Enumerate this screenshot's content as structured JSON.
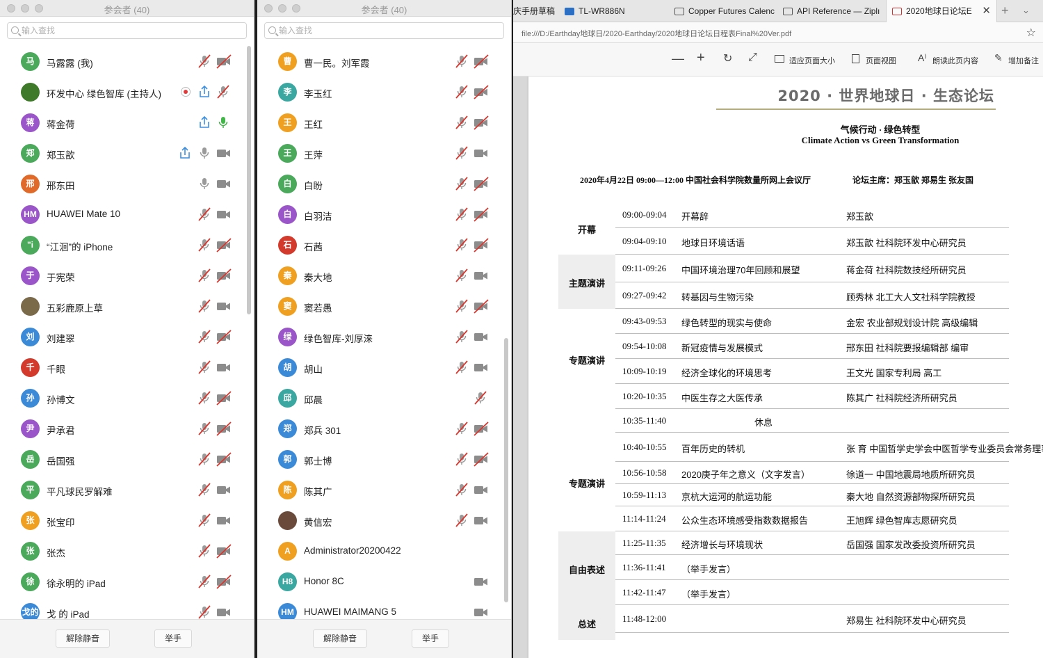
{
  "colors": {
    "red_slash": "#d9352c",
    "mic_green": "#43b649",
    "share_blue": "#3d8fe0",
    "record_red": "#e23a3a"
  },
  "left_panel": {
    "title": "参会者 (40)",
    "search_placeholder": "输入查找",
    "unmute_label": "解除静音",
    "raise_hand_label": "举手",
    "participants": [
      {
        "initial": "马",
        "name": "马露露 (我)",
        "color": "#4aa95a",
        "mic": "muted",
        "video": "off"
      },
      {
        "initial": "",
        "name": "环发中心 绿色智库 (主持人)",
        "color": "#3f7a2a",
        "mic": "muted",
        "video": "none",
        "recording": true,
        "sharing": true
      },
      {
        "initial": "蒋",
        "name": "蒋金荷",
        "color": "#9a55c8",
        "mic": "active",
        "video": "none",
        "sharing": true
      },
      {
        "initial": "郑",
        "name": "郑玉歆",
        "color": "#4aa95a",
        "mic": "on",
        "video": "on",
        "sharing": true
      },
      {
        "initial": "邢",
        "name": "邢东田",
        "color": "#e06a2a",
        "mic": "on",
        "video": "on"
      },
      {
        "initial": "HM",
        "name": "HUAWEI Mate 10",
        "color": "#9a55c8",
        "mic": "muted",
        "video": "on"
      },
      {
        "initial": "\"i",
        "name": "“江洄”的 iPhone",
        "color": "#4aa95a",
        "mic": "muted",
        "video": "off"
      },
      {
        "initial": "于",
        "name": "于宪荣",
        "color": "#9a55c8",
        "mic": "muted",
        "video": "off"
      },
      {
        "initial": "",
        "name": "五彩鹿原上草",
        "color": "#7a6a4a",
        "mic": "muted",
        "video": "on"
      },
      {
        "initial": "刘",
        "name": "刘建翠",
        "color": "#3a8ad8",
        "mic": "muted",
        "video": "off"
      },
      {
        "initial": "千",
        "name": "千眼",
        "color": "#d33a2c",
        "mic": "muted",
        "video": "on"
      },
      {
        "initial": "孙",
        "name": "孙博文",
        "color": "#3a8ad8",
        "mic": "muted",
        "video": "off"
      },
      {
        "initial": "尹",
        "name": "尹承君",
        "color": "#9a55c8",
        "mic": "muted",
        "video": "off"
      },
      {
        "initial": "岳",
        "name": "岳国强",
        "color": "#4aa95a",
        "mic": "muted",
        "video": "off"
      },
      {
        "initial": "平",
        "name": "平凡球民罗解难",
        "color": "#4aa95a",
        "mic": "muted",
        "video": "on"
      },
      {
        "initial": "张",
        "name": "张宝印",
        "color": "#f0a020",
        "mic": "muted",
        "video": "on"
      },
      {
        "initial": "张",
        "name": "张杰",
        "color": "#4aa95a",
        "mic": "muted",
        "video": "off"
      },
      {
        "initial": "徐",
        "name": "徐永明的 iPad",
        "color": "#4aa95a",
        "mic": "muted",
        "video": "off"
      },
      {
        "initial": "戈的",
        "name": "戈 的 iPad",
        "color": "#3a8ad8",
        "mic": "muted",
        "video": "on"
      }
    ]
  },
  "mid_panel": {
    "title": "参会者 (40)",
    "search_placeholder": "输入查找",
    "unmute_label": "解除静音",
    "raise_hand_label": "举手",
    "participants": [
      {
        "initial": "曹",
        "name": "曹一民。刘军霞",
        "color": "#f0a020",
        "mic": "muted",
        "video": "off"
      },
      {
        "initial": "李",
        "name": "李玉红",
        "color": "#3aa8a0",
        "mic": "muted",
        "video": "off"
      },
      {
        "initial": "王",
        "name": "王红",
        "color": "#f0a020",
        "mic": "muted",
        "video": "off"
      },
      {
        "initial": "王",
        "name": "王萍",
        "color": "#4aa95a",
        "mic": "muted",
        "video": "on"
      },
      {
        "initial": "白",
        "name": "白盼",
        "color": "#4aa95a",
        "mic": "muted",
        "video": "off"
      },
      {
        "initial": "白",
        "name": "白羽洁",
        "color": "#9a55c8",
        "mic": "muted",
        "video": "off"
      },
      {
        "initial": "石",
        "name": "石茜",
        "color": "#d33a2c",
        "mic": "muted",
        "video": "off"
      },
      {
        "initial": "秦",
        "name": "秦大地",
        "color": "#f0a020",
        "mic": "muted",
        "video": "on"
      },
      {
        "initial": "窦",
        "name": "窦若愚",
        "color": "#f0a020",
        "mic": "muted",
        "video": "off"
      },
      {
        "initial": "绿",
        "name": "绿色智库-刘厚涞",
        "color": "#9a55c8",
        "mic": "muted",
        "video": "on"
      },
      {
        "initial": "胡",
        "name": "胡山",
        "color": "#3a8ad8",
        "mic": "muted",
        "video": "on"
      },
      {
        "initial": "邱",
        "name": "邱晨",
        "color": "#3aa8a0",
        "mic": "muted",
        "video": "none"
      },
      {
        "initial": "郑",
        "name": "郑兵 301",
        "color": "#3a8ad8",
        "mic": "muted",
        "video": "off"
      },
      {
        "initial": "郭",
        "name": "郭士博",
        "color": "#3a8ad8",
        "mic": "muted",
        "video": "off"
      },
      {
        "initial": "陈",
        "name": "陈其广",
        "color": "#f0a020",
        "mic": "muted",
        "video": "on"
      },
      {
        "initial": "",
        "name": "黄信宏",
        "color": "#6a4a3a",
        "mic": "muted",
        "video": "on"
      },
      {
        "initial": "A",
        "name": "Administrator20200422",
        "color": "#f0a020",
        "mic": "none",
        "video": "none"
      },
      {
        "initial": "H8",
        "name": "Honor 8C",
        "color": "#3aa8a0",
        "mic": "none",
        "video": "on"
      },
      {
        "initial": "HM",
        "name": "HUAWEI MAIMANG 5",
        "color": "#3a8ad8",
        "mic": "none",
        "video": "on"
      }
    ]
  },
  "browser": {
    "tabs": [
      {
        "label": "庆手册草稿",
        "icon": "none"
      },
      {
        "label": "TL-WR886N",
        "icon": "tp-link-icon"
      },
      {
        "label": "Copper Futures Calenc",
        "icon": "page-icon"
      },
      {
        "label": "API Reference — Ziplı",
        "icon": "page-icon"
      },
      {
        "label": "2020地球日论坛E",
        "icon": "pdf-icon",
        "active": true
      }
    ],
    "url": "file:///D:/Earthday地球日/2020-Earthday/2020地球日论坛日程表Final%20Ver.pdf",
    "toolbar": {
      "fit_page": "适应页面大小",
      "page_view": "页面视图",
      "read_aloud": "朗读此页内容",
      "add_note": "增加备注"
    }
  },
  "document": {
    "title": "2020 · 世界地球日 · 生态论坛",
    "subtitle_cn": "气候行动 · 绿色转型",
    "subtitle_en": "Climate Action vs Green Transformation",
    "meta_left": "2020年4月22日 09:00—12:00 中国社会科学院数量所网上会议厅",
    "meta_right": "论坛主席：郑玉歆 郑易生 张友国",
    "sections": [
      {
        "label": "开幕"
      },
      {
        "label": "主题演讲"
      },
      {
        "label": "专题演讲"
      },
      {
        "label": "专题演讲"
      },
      {
        "label": "自由表述"
      },
      {
        "label": "总述"
      }
    ],
    "schedule": [
      {
        "time": "09:00-09:04",
        "topic": "开幕辞",
        "speaker": "郑玉歆"
      },
      {
        "time": "09:04-09:10",
        "topic": "地球日环境话语",
        "speaker": "郑玉歆 社科院环发中心研究员"
      },
      {
        "time": "09:11-09:26",
        "topic": "中国环境治理70年回顾和展望",
        "speaker": "蒋金荷 社科院数技经所研究员"
      },
      {
        "time": "09:27-09:42",
        "topic": "转基因与生物污染",
        "speaker": "顾秀林 北工大人文社科学院教授"
      },
      {
        "time": "09:43-09:53",
        "topic": "绿色转型的现实与使命",
        "speaker": "金宏 农业部规划设计院 高级编辑"
      },
      {
        "time": "09:54-10:08",
        "topic": "新冠疫情与发展模式",
        "speaker": "邢东田 社科院要报编辑部 编审"
      },
      {
        "time": "10:09-10:19",
        "topic": "经济全球化的环境思考",
        "speaker": "王文光 国家专利局 高工"
      },
      {
        "time": "10:20-10:35",
        "topic": "中医生存之大医传承",
        "speaker": "陈其广 社科院经济所研究员"
      },
      {
        "time": "10:35-11:40",
        "topic": "休息",
        "speaker": ""
      },
      {
        "time": "10:40-10:55",
        "topic": "百年历史的转机",
        "speaker": "张 育 中国哲学史学会中医哲学专业委员会常务理事"
      },
      {
        "time": "10:56-10:58",
        "topic": "2020庚子年之意义（文字发言）",
        "speaker": "徐道一 中国地震局地质所研究员"
      },
      {
        "time": "10:59-11:13",
        "topic": "京杭大运河的航运功能",
        "speaker": "秦大地 自然资源部物探所研究员"
      },
      {
        "time": "11:14-11:24",
        "topic": "公众生态环境感受指数数据报告",
        "speaker": "王旭辉 绿色智库志愿研究员"
      },
      {
        "time": "11:25-11:35",
        "topic": "经济增长与环境现状",
        "speaker": "岳国强 国家发改委投资所研究员"
      },
      {
        "time": "11:36-11:41",
        "topic": "（举手发言）",
        "speaker": ""
      },
      {
        "time": "11:42-11:47",
        "topic": "（举手发言）",
        "speaker": ""
      },
      {
        "time": "11:48-12:00",
        "topic": "",
        "speaker": "郑易生 社科院环发中心研究员"
      }
    ]
  }
}
